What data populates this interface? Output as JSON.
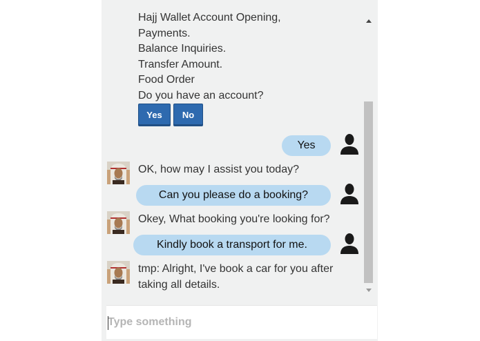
{
  "chat": {
    "intro_lines": [
      "Hajj Wallet Account Opening,",
      "Payments.",
      "Balance Inquiries.",
      "Transfer Amount.",
      "Food Order",
      "Do you have an account?"
    ],
    "choices": {
      "yes": "Yes",
      "no": "No"
    },
    "messages": [
      {
        "from": "user",
        "text": "Yes"
      },
      {
        "from": "bot",
        "text": "OK, how may I assist you today?"
      },
      {
        "from": "user",
        "text": "Can you please do a booking?"
      },
      {
        "from": "bot",
        "text": "Okey, What booking you're looking for?"
      },
      {
        "from": "user",
        "text": "Kindly book a transport for me."
      },
      {
        "from": "bot",
        "text": "tmp: Alright, I've book a car for you after taking all details."
      }
    ]
  },
  "input": {
    "placeholder": "Type something",
    "value": ""
  },
  "icons": {
    "user_avatar": "user-silhouette-icon",
    "bot_avatar": "bot-portrait-avatar"
  },
  "colors": {
    "panel_bg": "#f0f1f1",
    "user_bubble": "#b8d9f1",
    "choice_button": "#2e6aaf",
    "scrollbar_thumb": "#c1c1c1"
  }
}
